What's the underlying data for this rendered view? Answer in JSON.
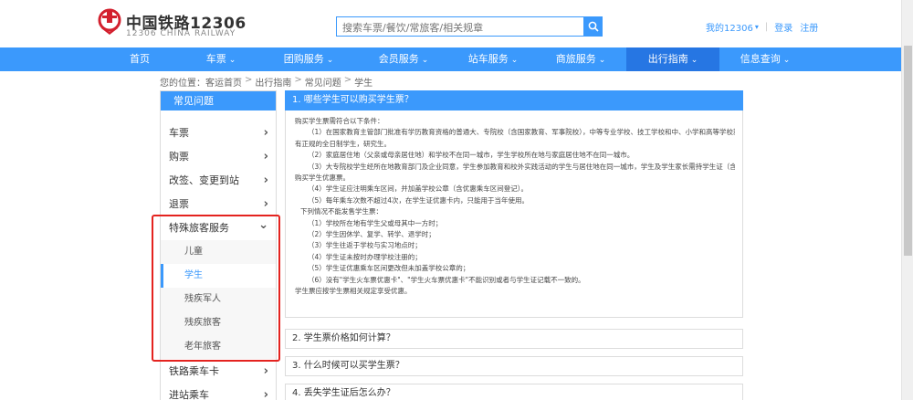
{
  "brand": {
    "name_cn": "中国铁路12306",
    "name_en": "12306 CHINA RAILWAY"
  },
  "search": {
    "placeholder": "搜索车票/餐饮/常旅客/相关规章"
  },
  "header_links": {
    "my": "我的12306",
    "login": "登录",
    "register": "注册"
  },
  "nav": [
    {
      "label": "首页",
      "has_chevron": false
    },
    {
      "label": "车票",
      "has_chevron": true
    },
    {
      "label": "团购服务",
      "has_chevron": true
    },
    {
      "label": "会员服务",
      "has_chevron": true
    },
    {
      "label": "站车服务",
      "has_chevron": true
    },
    {
      "label": "商旅服务",
      "has_chevron": true
    },
    {
      "label": "出行指南",
      "has_chevron": true
    },
    {
      "label": "信息查询",
      "has_chevron": true
    }
  ],
  "breadcrumb": [
    "您的位置：客运首页",
    "出行指南",
    "常见问题",
    "学生"
  ],
  "sidebar": {
    "title": "常见问题",
    "items": [
      {
        "label": "车票",
        "arrow": "›"
      },
      {
        "label": "购票",
        "arrow": "›"
      },
      {
        "label": "改签、变更到站",
        "arrow": "›"
      },
      {
        "label": "退票",
        "arrow": "›"
      },
      {
        "label": "特殊旅客服务",
        "arrow": "⌄"
      },
      {
        "label": "铁路乘车卡",
        "arrow": "›"
      },
      {
        "label": "进站乘车",
        "arrow": "›"
      }
    ],
    "sub_items": [
      "儿童",
      "学生",
      "残疾军人",
      "残疾旅客",
      "老年旅客"
    ]
  },
  "questions": [
    "1. 哪些学生可以购买学生票？",
    "2. 学生票价格如何计算？",
    "3. 什么时候可以买学生票？",
    "4. 丢失学生证后怎么办？"
  ],
  "answer_lines": [
    "购买学生票需符合以下条件：",
    "（1）在国家教育主管部门批准有学历教育资格的普通大、专院校（含国家教育、军事院校），中等专业学校、技工学校和中、小学和高等学校就读，",
    "有正规的全日制学生，研究生。",
    "（2）家庭居住地（父亲或母亲居住地）和学校不在同一城市，学生学校所在地与家庭居住地不在同一城市。",
    "（3）大专院校学生经所在地教育部门及企业同意，学生参加教育和校外实践活动的学生与居住地在同一城市，学生及学生家长需持学生证（含电子学生证）",
    "购买学生优惠票。",
    "（4）学生证应注明乘车区间，并加盖学校公章（含优惠乘车区间登记）。",
    "（5）每年乘车次数不超过4次，在学生证优惠卡内，只能用于当年使用。",
    "下列情况不能发售学生票：",
    "（1）学校所在地有学生父或母其中一方时；",
    "（2）学生因休学、复学、转学、退学时；",
    "（3）学生往返于学校与实习地点时；",
    "（4）学生证未按时办理学校注册的；",
    "（5）学生证优惠乘车区间更改但未加盖学校公章的；",
    "（6）没有\"学生火车票优惠卡\"、\"学生火车票优惠卡\"不能识别或者与学生证记载不一致的。",
    "学生票应按学生票相关规定享受优惠。"
  ]
}
